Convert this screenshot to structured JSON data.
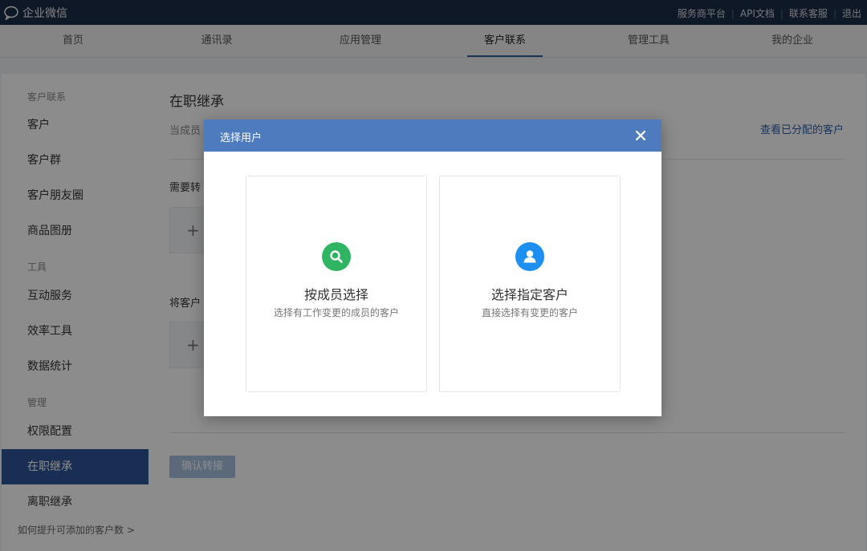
{
  "app": {
    "title": "企业微信"
  },
  "header_links": [
    "服务商平台",
    "API文档",
    "联系客服",
    "退出"
  ],
  "nav": {
    "tabs": [
      {
        "label": "首页"
      },
      {
        "label": "通讯录"
      },
      {
        "label": "应用管理"
      },
      {
        "label": "客户联系"
      },
      {
        "label": "管理工具"
      },
      {
        "label": "我的企业"
      }
    ],
    "active": "客户联系"
  },
  "sidebar": {
    "sections": [
      "客户联系",
      "工具",
      "管理"
    ],
    "items": [
      {
        "label": "客户"
      },
      {
        "label": "客户群"
      },
      {
        "label": "客户朋友圈"
      },
      {
        "label": "商品图册"
      },
      {
        "label": "互动服务"
      },
      {
        "label": "效率工具"
      },
      {
        "label": "数据统计"
      },
      {
        "label": "权限配置"
      },
      {
        "label": "在职继承"
      },
      {
        "label": "离职继承"
      }
    ],
    "active": "在职继承",
    "footer": "如何提升可添加的客户数 >"
  },
  "main": {
    "title": "在职继承",
    "desc_prefix": "当成员",
    "view_assigned": "查看已分配的客户",
    "field1_label": "需要转",
    "field2_label": "将客户",
    "add_symbol": "+",
    "confirm": "确认转接"
  },
  "modal": {
    "title": "选择用户",
    "close_symbol": "✕",
    "cards": [
      {
        "title": "按成员选择",
        "subtitle": "选择有工作变更的成员的客户",
        "icon": "search-icon",
        "color": "#2fb561"
      },
      {
        "title": "选择指定客户",
        "subtitle": "直接选择有变更的客户",
        "icon": "user-icon",
        "color": "#1d8ff0"
      }
    ]
  },
  "colors": {
    "topbar": "#1d2c45",
    "accent": "#2d5596",
    "modal_header": "#4d7bbd",
    "link": "#2b5ea8"
  }
}
